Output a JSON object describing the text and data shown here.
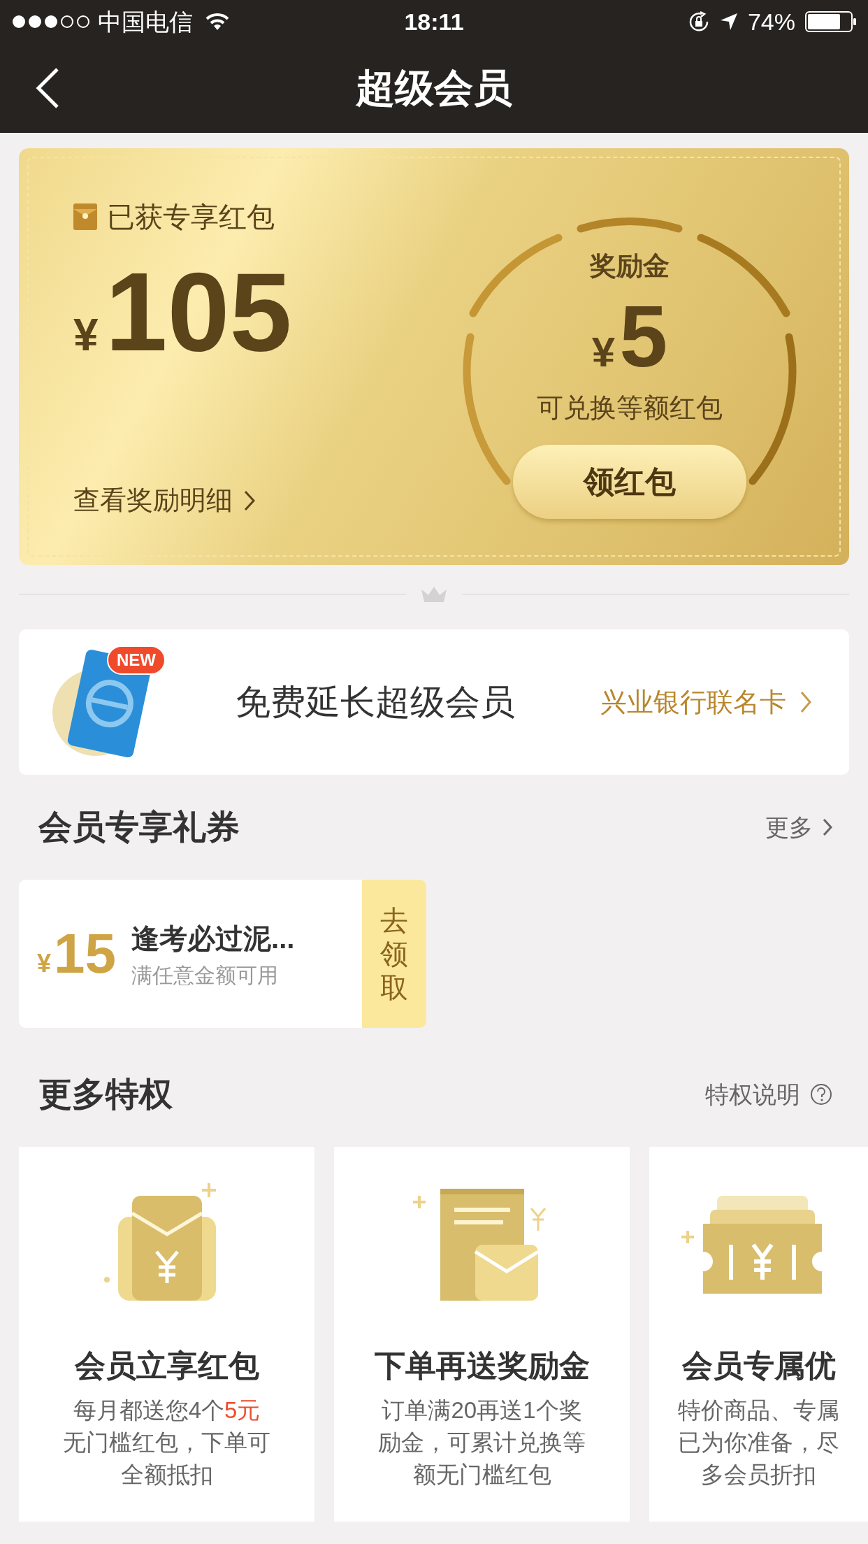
{
  "status_bar": {
    "carrier": "中国电信",
    "time": "18:11",
    "battery": "74%"
  },
  "nav": {
    "title": "超级会员"
  },
  "reward_card": {
    "label": "已获专享红包",
    "currency": "¥",
    "amount": "105",
    "details_link": "查看奖励明细",
    "bonus_title": "奖励金",
    "bonus_currency": "¥",
    "bonus_amount": "5",
    "bonus_note": "可兑换等额红包",
    "claim_button": "领红包"
  },
  "bank_banner": {
    "badge": "NEW",
    "text": "免费延长超级会员",
    "link": "兴业银行联名卡"
  },
  "coupons": {
    "title": "会员专享礼券",
    "more": "更多",
    "items": [
      {
        "currency": "¥",
        "amount": "15",
        "name": "逢考必过泥...",
        "condition": "满任意金额可用",
        "action": "去领取"
      }
    ]
  },
  "privileges": {
    "title": "更多特权",
    "info_link": "特权说明",
    "items": [
      {
        "kind": "envelope",
        "title": "会员立享红包",
        "lines": [
          [
            {
              "text": "每月都送您4个",
              "highlight": false
            },
            {
              "text": "5元",
              "highlight": true
            }
          ],
          [
            {
              "text": "无门槛红包，下单可",
              "highlight": false
            }
          ],
          [
            {
              "text": "全额抵扣",
              "highlight": false
            }
          ]
        ]
      },
      {
        "kind": "receipt",
        "title": "下单再送奖励金",
        "lines": [
          [
            {
              "text": "订单满20再送1个奖",
              "highlight": false
            }
          ],
          [
            {
              "text": "励金，可累计兑换等",
              "highlight": false
            }
          ],
          [
            {
              "text": "额无门槛红包",
              "highlight": false
            }
          ]
        ]
      },
      {
        "kind": "ticket",
        "title": "会员专属优",
        "lines": [
          [
            {
              "text": "特价商品、专属",
              "highlight": false
            }
          ],
          [
            {
              "text": "已为你准备，尽",
              "highlight": false
            }
          ],
          [
            {
              "text": "多会员折扣",
              "highlight": false
            }
          ]
        ]
      }
    ]
  }
}
